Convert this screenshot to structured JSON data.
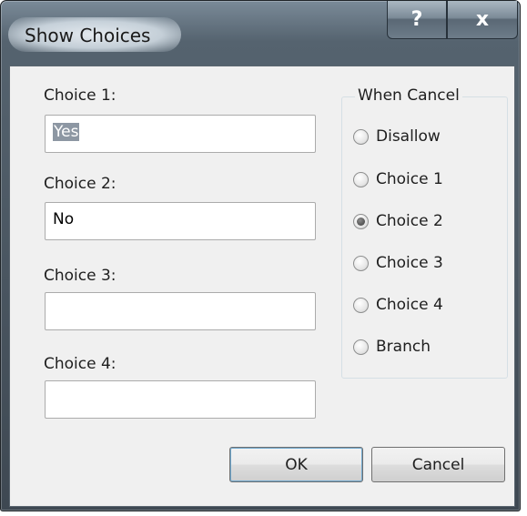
{
  "window": {
    "title": "Show Choices",
    "help_glyph": "?",
    "close_glyph": "x"
  },
  "fields": [
    {
      "label": "Choice 1:",
      "value": "Yes",
      "selected": true
    },
    {
      "label": "Choice 2:",
      "value": "No",
      "selected": false
    },
    {
      "label": "Choice 3:",
      "value": "",
      "selected": false
    },
    {
      "label": "Choice 4:",
      "value": "",
      "selected": false
    }
  ],
  "when_cancel": {
    "title": "When Cancel",
    "options": [
      "Disallow",
      "Choice 1",
      "Choice 2",
      "Choice 3",
      "Choice 4",
      "Branch"
    ],
    "selected": "Choice 2"
  },
  "buttons": {
    "ok": "OK",
    "cancel": "Cancel"
  },
  "icons": {
    "help": "help-icon",
    "close": "close-icon"
  }
}
